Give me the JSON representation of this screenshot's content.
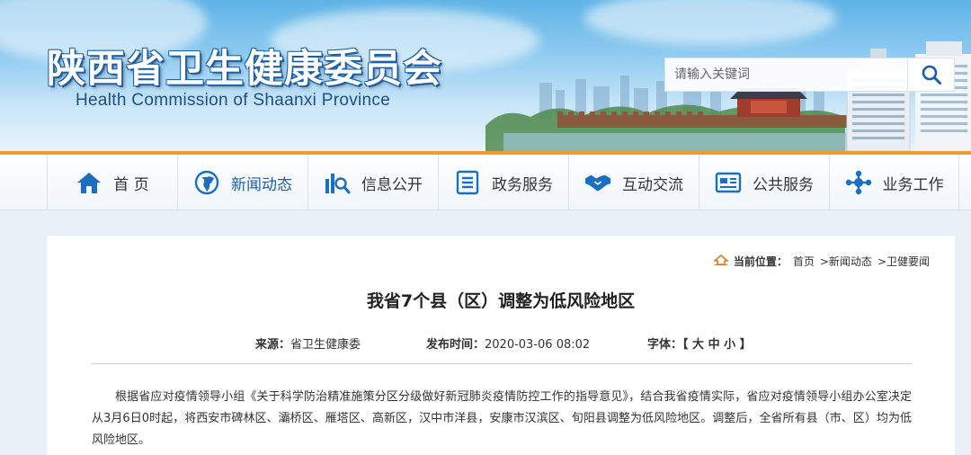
{
  "header": {
    "site_title": "陕西省卫生健康委员会",
    "site_subtitle": "Health Commission of Shaanxi Province",
    "search": {
      "placeholder": "请输入关键词",
      "icon": "search-icon"
    }
  },
  "nav": {
    "items": [
      {
        "label": "首 页",
        "icon": "home-icon"
      },
      {
        "label": "新闻动态",
        "icon": "globe-icon"
      },
      {
        "label": "信息公开",
        "icon": "chart-search-icon"
      },
      {
        "label": "政务服务",
        "icon": "document-list-icon"
      },
      {
        "label": "互动交流",
        "icon": "handshake-icon"
      },
      {
        "label": "公共服务",
        "icon": "newspaper-icon"
      },
      {
        "label": "业务工作",
        "icon": "network-icon"
      }
    ],
    "active_index": 1
  },
  "breadcrumb": {
    "label": "当前位置：",
    "items": [
      "首页",
      ">新闻动态",
      ">卫健要闻"
    ],
    "icon": "home-small-icon"
  },
  "article": {
    "title": "我省7个县（区）调整为低风险地区",
    "source_label": "来源：",
    "source": "省卫生健康委",
    "date_label": "发布时间：",
    "date": "2020-03-06 08:02",
    "font_label": "字体：",
    "font_sizes": "【 大 中 小 】",
    "body": "根据省应对疫情领导小组《关于科学防治精准施策分区分级做好新冠肺炎疫情防控工作的指导意见》，结合我省疫情实际，省应对疫情领导小组办公室决定从3月6日0时起，将西安市碑林区、灞桥区、雁塔区、高新区，汉中市洋县，安康市汉滨区、旬阳县调整为低风险地区。调整后，全省所有县（市、区）均为低风险地区。"
  },
  "colors": {
    "accent_orange": "#f39a2d",
    "brand_blue": "#1b5ea8",
    "title_stroke": "#1c5fa4"
  }
}
